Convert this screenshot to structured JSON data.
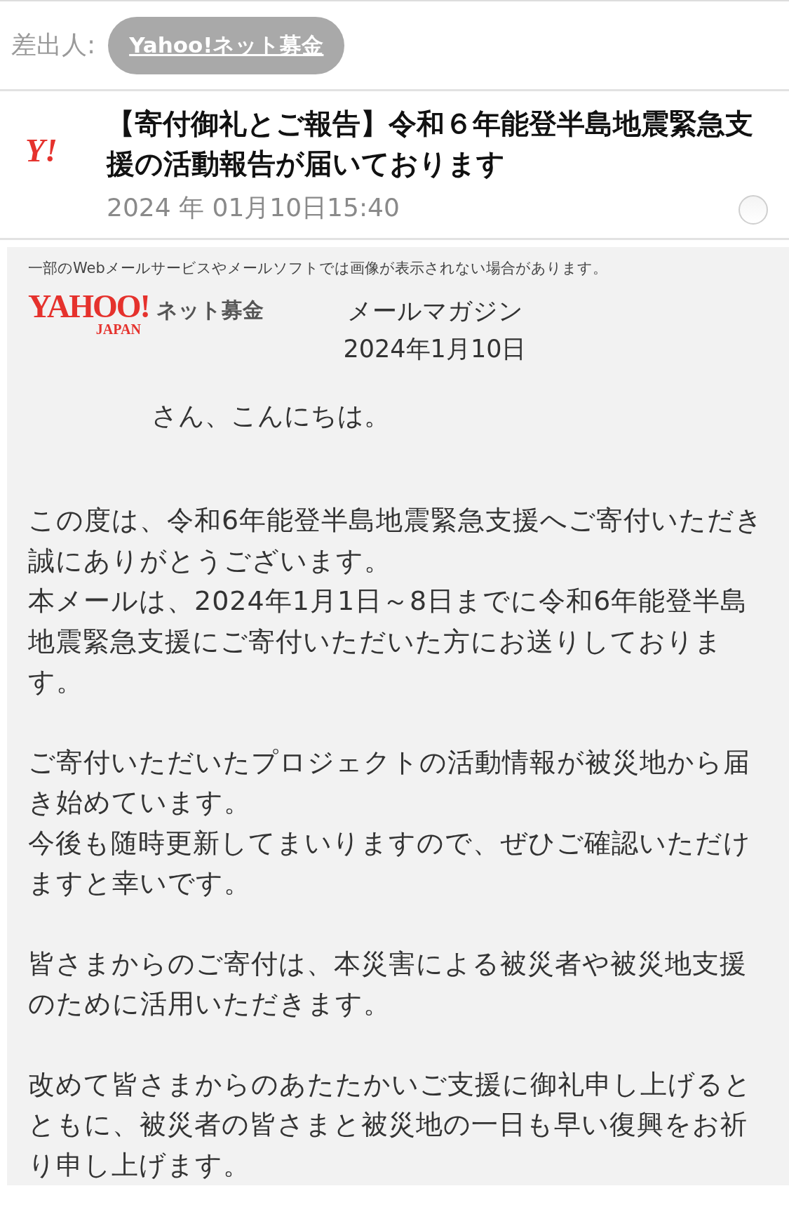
{
  "sender": {
    "label": "差出人:",
    "name": "Yahoo!ネット募金"
  },
  "message": {
    "avatar": "Y!",
    "subject": "【寄付御礼とご報告】令和６年能登半島地震緊急支援の活動報告が届いております",
    "date": "2024 年 01月10日15:40",
    "read": false
  },
  "body": {
    "notice": "一部のWebメールサービスやメールソフトでは画像が表示されない場合があります。",
    "logo": {
      "brand": "YAHOO!",
      "sub": "JAPAN",
      "service": "ネット募金"
    },
    "heading": "メールマガジン",
    "issue_date": "2024年1月10日",
    "greeting": "さん、こんにちは。",
    "paragraphs": [
      [
        "この度は、令和6年能登半島地震緊急支援へご寄付いただき誠にありがとうございます。",
        "本メールは、2024年1月1日～8日までに令和6年能登半島地震緊急支援にご寄付いただいた方にお送りしております。"
      ],
      [
        "ご寄付いただいたプロジェクトの活動情報が被災地から届き始めています。",
        "今後も随時更新してまいりますので、ぜひご確認いただけますと幸いです。"
      ],
      [
        "皆さまからのご寄付は、本災害による被災者や被災地支援のために活用いただきます。"
      ],
      [
        "改めて皆さまからのあたたかいご支援に御礼申し上げるとともに、被災者の皆さまと被災地の一日も早い復興をお祈り申し上げます。"
      ]
    ]
  }
}
